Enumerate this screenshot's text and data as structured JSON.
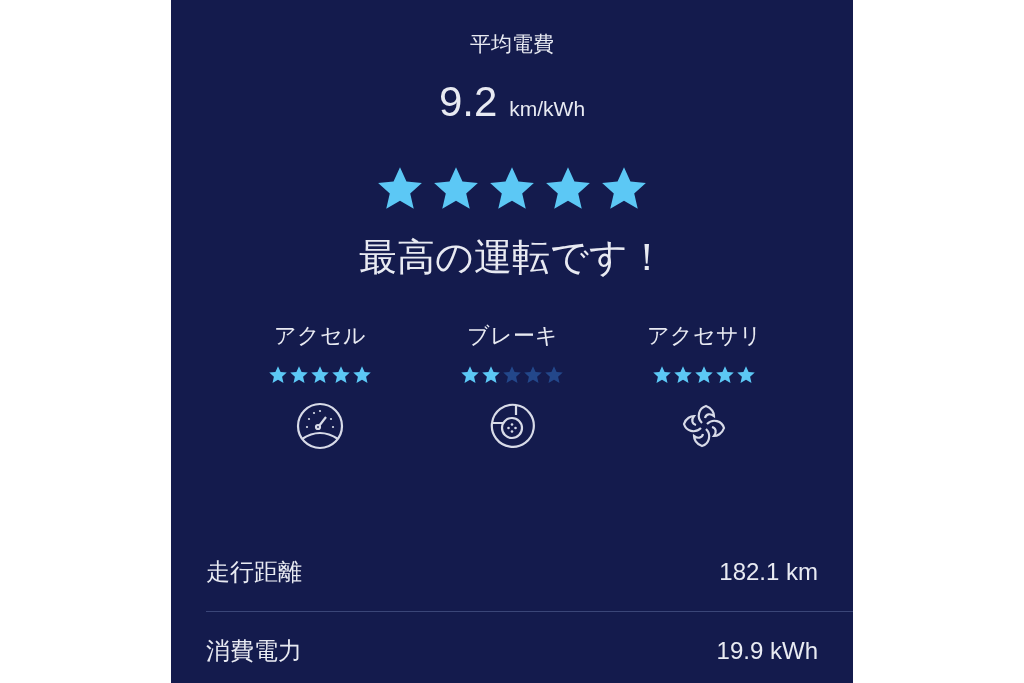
{
  "summary": {
    "title": "平均電費",
    "value": "9.2",
    "unit": "km/kWh",
    "stars": 5,
    "message": "最高の運転です！"
  },
  "categories": [
    {
      "kind": "accelerator",
      "label": "アクセル",
      "stars": 5
    },
    {
      "kind": "brake",
      "label": "ブレーキ",
      "stars": 2
    },
    {
      "kind": "accessory",
      "label": "アクセサリ",
      "stars": 5
    }
  ],
  "stats": [
    {
      "label": "走行距離",
      "value": "182.1 km"
    },
    {
      "label": "消費電力",
      "value": "19.9 kWh"
    }
  ]
}
